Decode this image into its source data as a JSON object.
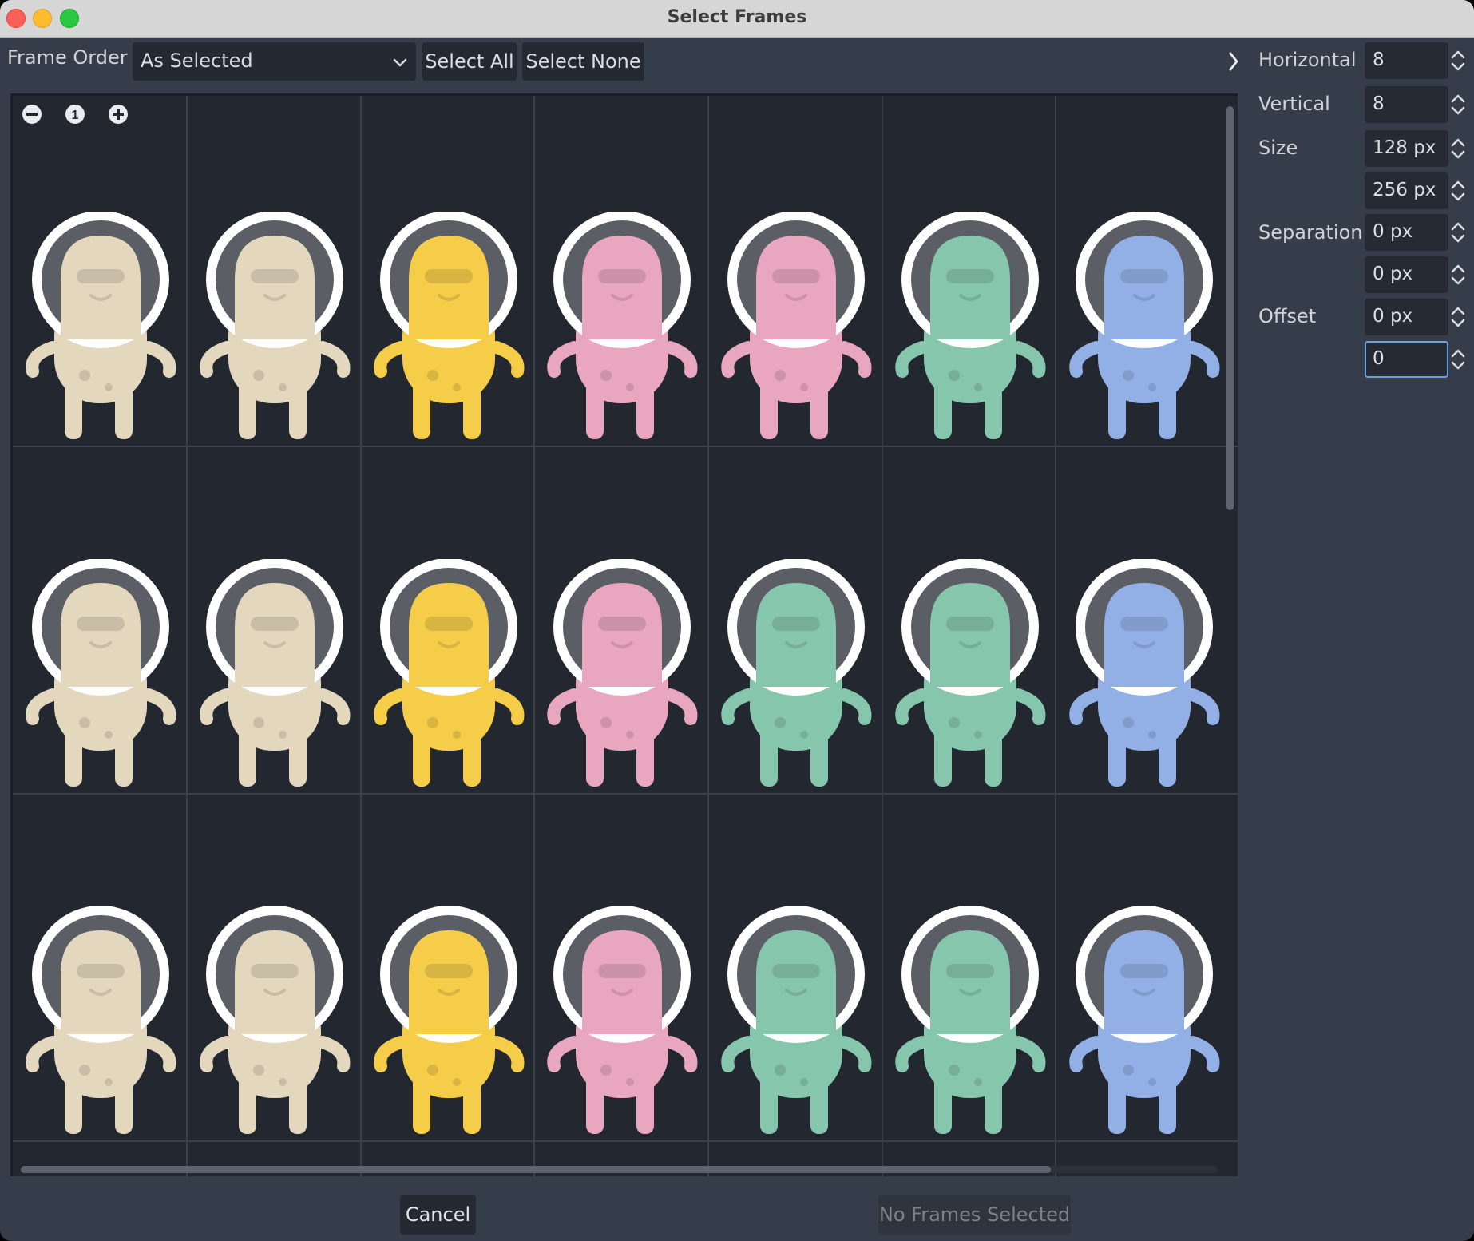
{
  "window": {
    "title": "Select Frames"
  },
  "toolbar": {
    "frame_order_label": "Frame Order",
    "frame_order_value": "As Selected",
    "select_all": "Select All",
    "select_none": "Select None"
  },
  "zoom": {
    "zoom_out": "zoom-out",
    "zoom_reset": "1",
    "zoom_in": "zoom-in"
  },
  "grid": {
    "columns_visible": 7,
    "rows_visible": 3,
    "rows": [
      [
        "cream",
        "cream",
        "yellow",
        "pink",
        "pink",
        "green",
        "blue"
      ],
      [
        "cream",
        "cream",
        "yellow",
        "pink",
        "green",
        "green",
        "blue"
      ],
      [
        "cream",
        "cream",
        "yellow",
        "pink",
        "green",
        "green",
        "blue"
      ]
    ],
    "colors": {
      "cream": "#e3d7bd",
      "yellow": "#f5cd49",
      "pink": "#e8a6bf",
      "green": "#86c6ac",
      "blue": "#93b0e6"
    }
  },
  "settings": {
    "horizontal_label": "Horizontal",
    "horizontal_value": "8",
    "vertical_label": "Vertical",
    "vertical_value": "8",
    "size_label": "Size",
    "size_x": "128 px",
    "size_y": "256 px",
    "separation_label": "Separation",
    "separation_x": "0 px",
    "separation_y": "0 px",
    "offset_label": "Offset",
    "offset_x": "0 px",
    "offset_y": "0"
  },
  "footer": {
    "cancel": "Cancel",
    "confirm": "No Frames Selected"
  },
  "theme": {
    "panel_bg": "#363d4a",
    "canvas_bg": "#232830",
    "focus_accent": "#6c9fe0"
  }
}
